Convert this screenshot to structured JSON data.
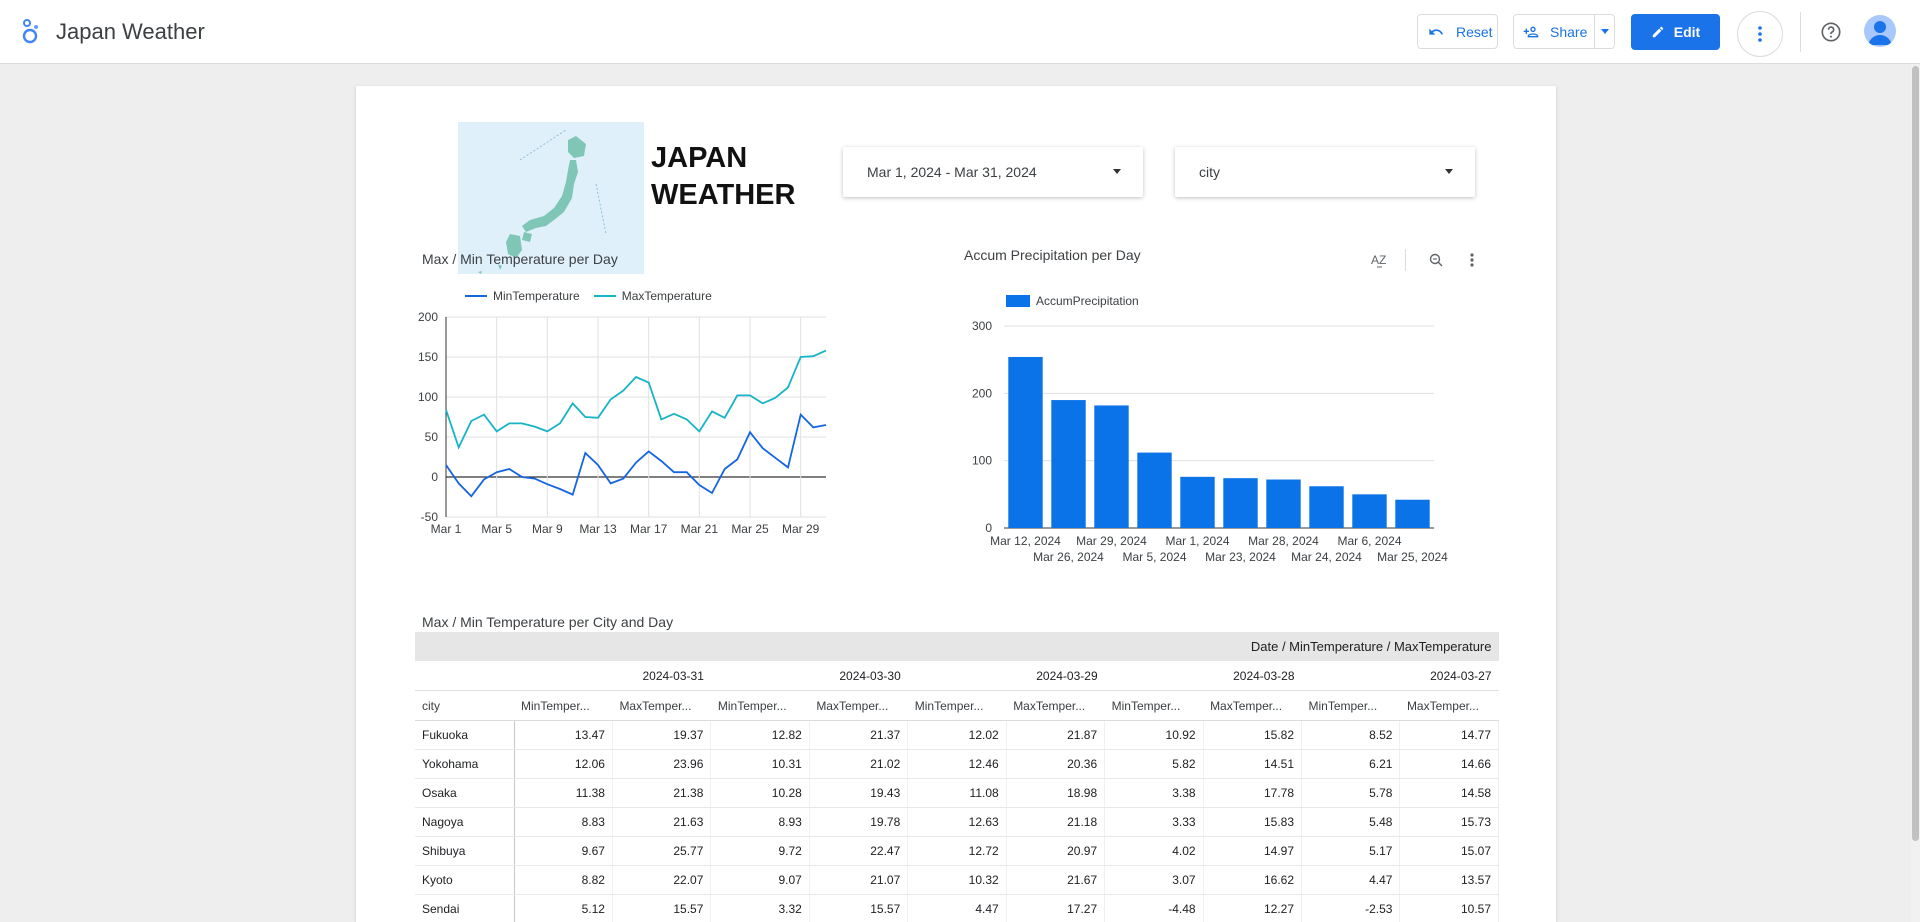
{
  "app": {
    "title": "Japan Weather"
  },
  "toolbar": {
    "reset_label": "Reset",
    "share_label": "Share",
    "edit_label": "Edit"
  },
  "icons": {
    "logo": "looker-studio-logo-icon",
    "reset": "undo-icon",
    "share": "person-add-icon",
    "share_menu": "caret-down-icon",
    "edit": "pencil-icon",
    "more": "more-vert-icon",
    "help": "help-circle-icon",
    "account": "avatar-icon"
  },
  "colors": {
    "accent": "#1a73e8",
    "bar": "#0b73e8",
    "min_line": "#1565e0",
    "max_line": "#17b3c7"
  },
  "report": {
    "title_line1": "JAPAN",
    "title_line2": "WEATHER",
    "date_range": "Mar 1, 2024 - Mar 31, 2024",
    "city_filter": "city"
  },
  "line_chart_title": "Max / Min Temperature per Day",
  "bar_chart_title": "Accum Precipitation per Day",
  "table_title": "Max / Min Temperature per City and Day",
  "chart_data": [
    {
      "type": "line",
      "title": "Max / Min Temperature per Day",
      "x": [
        "Mar 1",
        "Mar 2",
        "Mar 3",
        "Mar 4",
        "Mar 5",
        "Mar 6",
        "Mar 7",
        "Mar 8",
        "Mar 9",
        "Mar 10",
        "Mar 11",
        "Mar 12",
        "Mar 13",
        "Mar 14",
        "Mar 15",
        "Mar 16",
        "Mar 17",
        "Mar 18",
        "Mar 19",
        "Mar 20",
        "Mar 21",
        "Mar 22",
        "Mar 23",
        "Mar 24",
        "Mar 25",
        "Mar 26",
        "Mar 27",
        "Mar 28",
        "Mar 29",
        "Mar 30",
        "Mar 31"
      ],
      "x_ticks": [
        "Mar 1",
        "Mar 5",
        "Mar 9",
        "Mar 13",
        "Mar 17",
        "Mar 21",
        "Mar 25",
        "Mar 29"
      ],
      "ylim": [
        -50,
        200
      ],
      "y_ticks": [
        200,
        150,
        100,
        50,
        0,
        -50
      ],
      "series": [
        {
          "name": "MinTemperature",
          "color": "#1565e0",
          "values": [
            15,
            -8,
            -24,
            -3,
            6,
            10,
            0,
            -2,
            -9,
            -15,
            -22,
            30,
            15,
            -8,
            -2,
            18,
            32,
            20,
            6,
            6,
            -10,
            -20,
            10,
            22,
            56,
            36,
            24,
            12,
            78,
            62,
            65
          ]
        },
        {
          "name": "MaxTemperature",
          "color": "#17b3c7",
          "values": [
            84,
            37,
            70,
            78,
            57,
            67,
            67,
            63,
            57,
            67,
            92,
            75,
            74,
            97,
            108,
            125,
            118,
            72,
            79,
            72,
            57,
            82,
            74,
            102,
            102,
            92,
            99,
            112,
            150,
            151,
            158
          ]
        }
      ],
      "legend": "top"
    },
    {
      "type": "bar",
      "title": "Accum Precipitation per Day",
      "categories": [
        "Mar 12, 2024",
        "Mar 26, 2024",
        "Mar 29, 2024",
        "Mar 5, 2024",
        "Mar 1, 2024",
        "Mar 23, 2024",
        "Mar 28, 2024",
        "Mar 24, 2024",
        "Mar 6, 2024",
        "Mar 25, 2024"
      ],
      "series": [
        {
          "name": "AccumPrecipitation",
          "color": "#0b73e8",
          "values": [
            254,
            190,
            182,
            112,
            76,
            74,
            72,
            62,
            50,
            42
          ]
        }
      ],
      "ylim": [
        0,
        300
      ],
      "y_ticks": [
        300,
        200,
        100,
        0
      ],
      "legend": "top-left"
    }
  ],
  "pivot": {
    "header_band": "Date / MinTemperature / MaxTemperature",
    "row_dim": "city",
    "dates": [
      "2024-03-31",
      "2024-03-30",
      "2024-03-29",
      "2024-03-28",
      "2024-03-27"
    ],
    "metric_min": "MinTemper...",
    "metric_max": "MaxTemper...",
    "rows": [
      {
        "city": "Fukuoka",
        "values": [
          "13.47",
          "19.37",
          "12.82",
          "21.37",
          "12.02",
          "21.87",
          "10.92",
          "15.82",
          "8.52",
          "14.77"
        ]
      },
      {
        "city": "Yokohama",
        "values": [
          "12.06",
          "23.96",
          "10.31",
          "21.02",
          "12.46",
          "20.36",
          "5.82",
          "14.51",
          "6.21",
          "14.66"
        ]
      },
      {
        "city": "Osaka",
        "values": [
          "11.38",
          "21.38",
          "10.28",
          "19.43",
          "11.08",
          "18.98",
          "3.38",
          "17.78",
          "5.78",
          "14.58"
        ]
      },
      {
        "city": "Nagoya",
        "values": [
          "8.83",
          "21.63",
          "8.93",
          "19.78",
          "12.63",
          "21.18",
          "3.33",
          "15.83",
          "5.48",
          "15.73"
        ]
      },
      {
        "city": "Shibuya",
        "values": [
          "9.67",
          "25.77",
          "9.72",
          "22.47",
          "12.72",
          "20.97",
          "4.02",
          "14.97",
          "5.17",
          "15.07"
        ]
      },
      {
        "city": "Kyoto",
        "values": [
          "8.82",
          "22.07",
          "9.07",
          "21.07",
          "10.32",
          "21.67",
          "3.07",
          "16.62",
          "4.47",
          "13.57"
        ]
      },
      {
        "city": "Sendai",
        "values": [
          "5.12",
          "15.57",
          "3.32",
          "15.57",
          "4.47",
          "17.27",
          "-4.48",
          "12.27",
          "-2.53",
          "10.57"
        ]
      }
    ]
  }
}
